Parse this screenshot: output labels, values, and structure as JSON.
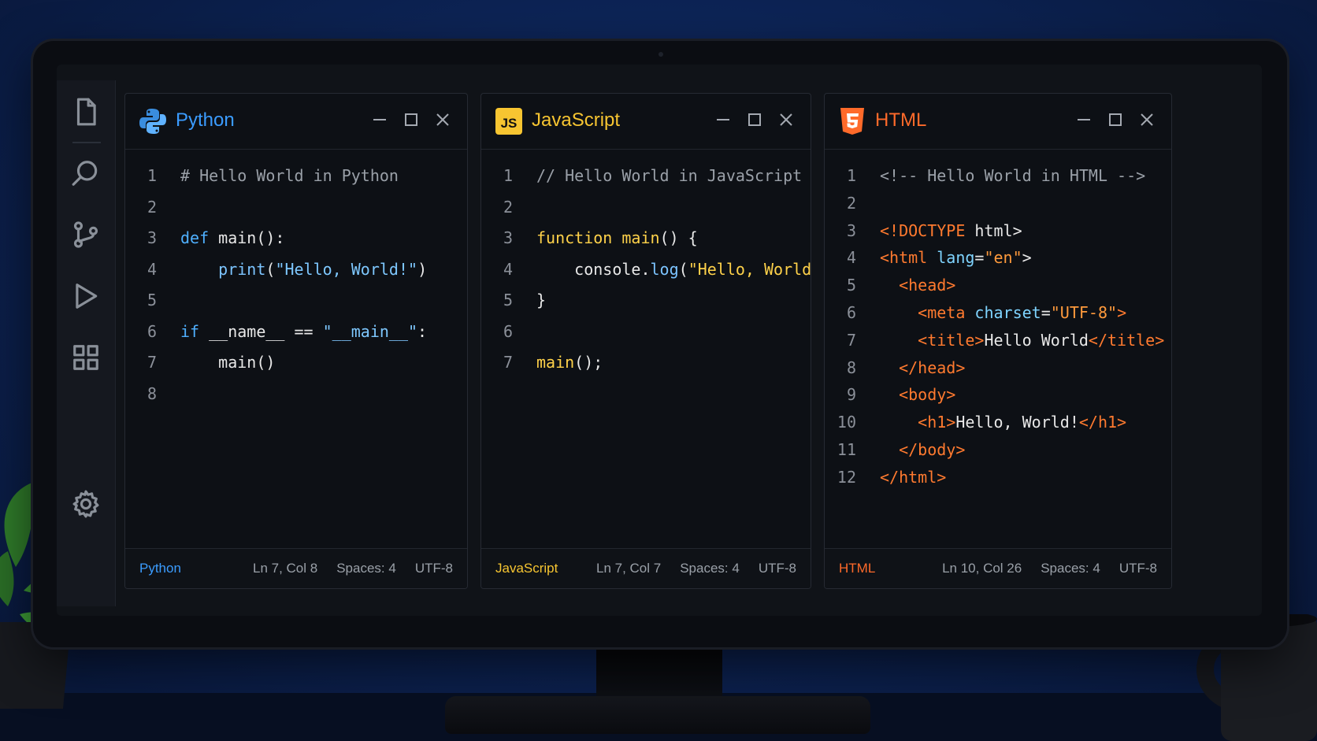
{
  "editors": [
    {
      "title": "Python",
      "accent": "#3b9cff",
      "logo": "python-logo",
      "lines": [
        [
          [
            "# Hello World in Python",
            "com"
          ]
        ],
        [],
        [
          [
            "def ",
            "kw"
          ],
          [
            "main",
            "txt"
          ],
          [
            "():",
            "txt"
          ]
        ],
        [
          [
            "    ",
            "txt"
          ],
          [
            "print",
            "fn"
          ],
          [
            "(",
            "txt"
          ],
          [
            "\"Hello, World!\"",
            "strb"
          ],
          [
            ")",
            "txt"
          ]
        ],
        [],
        [
          [
            "if ",
            "kw"
          ],
          [
            "__name__",
            "txt"
          ],
          [
            " == ",
            "txt"
          ],
          [
            "\"__main__\"",
            "strb"
          ],
          [
            ":",
            "txt"
          ]
        ],
        [
          [
            "    ",
            "txt"
          ],
          [
            "main()",
            "txt"
          ]
        ],
        []
      ],
      "status": {
        "language": "Python",
        "position": "Ln 7, Col 8",
        "indent": "Spaces: 4",
        "encoding": "UTF-8"
      }
    },
    {
      "title": "JavaScript",
      "accent": "#f7c531",
      "logo": "js-logo",
      "lines": [
        [
          [
            "// Hello World in JavaScript",
            "com"
          ]
        ],
        [],
        [
          [
            "function ",
            "jkw"
          ],
          [
            "main",
            "jfn"
          ],
          [
            "() {",
            "txt"
          ]
        ],
        [
          [
            "    ",
            "txt"
          ],
          [
            "console",
            "txt"
          ],
          [
            ".",
            "txt"
          ],
          [
            "log",
            "fn"
          ],
          [
            "(",
            "txt"
          ],
          [
            "\"Hello, World!\"",
            "str"
          ],
          [
            ");",
            "txt"
          ]
        ],
        [
          [
            "}",
            "txt"
          ]
        ],
        [],
        [
          [
            "main",
            "jfn"
          ],
          [
            "();",
            "txt"
          ]
        ]
      ],
      "status": {
        "language": "JavaScript",
        "position": "Ln 7, Col 7",
        "indent": "Spaces: 4",
        "encoding": "UTF-8"
      }
    },
    {
      "title": "HTML",
      "accent": "#ff6a2a",
      "logo": "html5-logo",
      "lines": [
        [
          [
            "<!-- Hello World in HTML -->",
            "com"
          ]
        ],
        [],
        [
          [
            "<!DOCTYPE ",
            "tag"
          ],
          [
            "html",
            "txt"
          ],
          [
            ">",
            "txt"
          ]
        ],
        [
          [
            "<html ",
            "tag"
          ],
          [
            "lang",
            "attr"
          ],
          [
            "=",
            "txt"
          ],
          [
            "\"en\"",
            "hstr"
          ],
          [
            ">",
            "txt"
          ]
        ],
        [
          [
            "  <head>",
            "tag"
          ]
        ],
        [
          [
            "    <meta ",
            "tag"
          ],
          [
            "charset",
            "attr"
          ],
          [
            "=",
            "txt"
          ],
          [
            "\"UTF-8\"",
            "hstr"
          ],
          [
            ">",
            "tag"
          ]
        ],
        [
          [
            "    <title>",
            "tag"
          ],
          [
            "Hello World",
            "txt"
          ],
          [
            "</title>",
            "tag"
          ]
        ],
        [
          [
            "  </head>",
            "tag"
          ]
        ],
        [
          [
            "  <body>",
            "tag"
          ]
        ],
        [
          [
            "    <h1>",
            "tag"
          ],
          [
            "Hello, World!",
            "txt"
          ],
          [
            "</h1>",
            "tag"
          ]
        ],
        [
          [
            "  </body>",
            "tag"
          ]
        ],
        [
          [
            "</html>",
            "tag"
          ]
        ]
      ],
      "status": {
        "language": "HTML",
        "position": "Ln 10, Col 26",
        "indent": "Spaces: 4",
        "encoding": "UTF-8"
      }
    }
  ]
}
